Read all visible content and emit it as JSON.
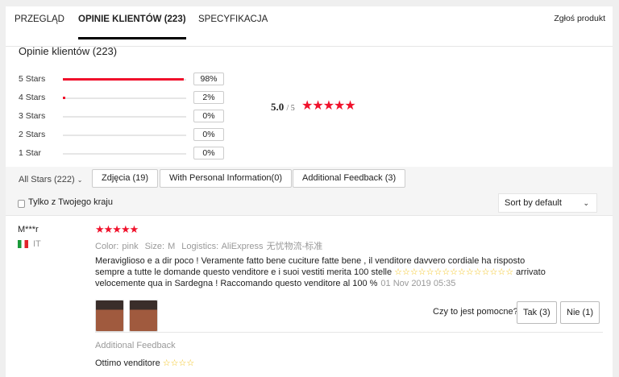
{
  "tabs": [
    {
      "label": "PRZEGLĄD"
    },
    {
      "label": "OPINIE KLIENTÓW (223)"
    },
    {
      "label": "SPECYFIKACJA"
    }
  ],
  "report": "Zgłoś produkt",
  "summary": {
    "title": "Opinie klientów (223)",
    "rows": [
      {
        "label": "5 Stars",
        "pct": "98%",
        "value": 98
      },
      {
        "label": "4 Stars",
        "pct": "2%",
        "value": 2
      },
      {
        "label": "3 Stars",
        "pct": "0%",
        "value": 0
      },
      {
        "label": "2 Stars",
        "pct": "0%",
        "value": 0
      },
      {
        "label": "1 Star",
        "pct": "0%",
        "value": 0
      }
    ],
    "average": "5.0",
    "outof": "/ 5",
    "stars": "★★★★★",
    "accent": "#f0112b"
  },
  "filters": {
    "all_stars": "All Stars (222)",
    "photos": "Zdjęcia (19)",
    "personal": "With Personal Information(0)",
    "additional": "Additional Feedback (3)",
    "country_only": "Tylko z Twojego kraju",
    "sort": "Sort by default"
  },
  "review": {
    "user": "M***r",
    "country": "IT",
    "stars": "★★★★★",
    "color": "Color: pink",
    "size": "Size: M",
    "logistics": "Logistics: AliExpress 无忧物流-标准",
    "text1": "Meraviglioso e a dir poco ! Veramente fatto bene cuciture fatte bene , il venditore davvero cordiale ha risposto sempre a tutte le domande questo venditore e i suoi vestiti merita 100 stelle ",
    "emoji": "☆☆☆☆☆☆☆☆☆☆☆☆☆☆☆",
    "text2": " arrivato velocemente qua in Sardegna ! Raccomando questo venditore al 100 %",
    "date": "01 Nov 2019 05:35",
    "helpful": "Czy to jest pomocne?",
    "yes": "Tak (3)",
    "no": "Nie (1)",
    "additional_label": "Additional Feedback",
    "additional_text": "Ottimo venditore ",
    "additional_emoji": "☆☆☆☆"
  }
}
